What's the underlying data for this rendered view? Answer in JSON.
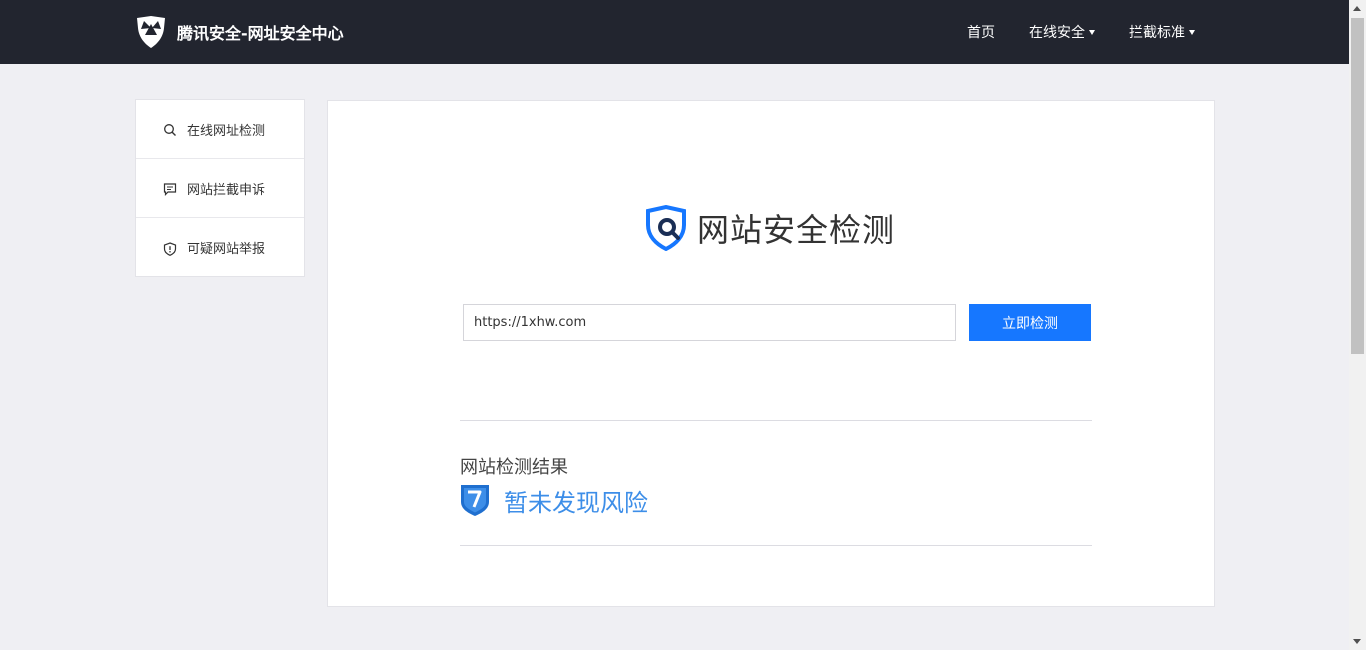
{
  "header": {
    "title": "腾讯安全-网址安全中心",
    "nav": [
      {
        "label": "首页",
        "dropdown": false
      },
      {
        "label": "在线安全",
        "dropdown": true
      },
      {
        "label": "拦截标准",
        "dropdown": true
      }
    ]
  },
  "sidebar": {
    "items": [
      {
        "label": "在线网址检测",
        "icon": "search-icon"
      },
      {
        "label": "网站拦截申诉",
        "icon": "message-icon"
      },
      {
        "label": "可疑网站举报",
        "icon": "shield-alert-icon"
      }
    ]
  },
  "main": {
    "hero_title": "网站安全检测",
    "url_input_value": "https://1xhw.com",
    "check_button_label": "立即检测",
    "result_heading": "网站检测结果",
    "result_status": "暂未发现风险"
  },
  "colors": {
    "header_bg": "#22252f",
    "page_bg": "#efeff3",
    "accent": "#1677ff",
    "result_text": "#3d8ee8"
  }
}
